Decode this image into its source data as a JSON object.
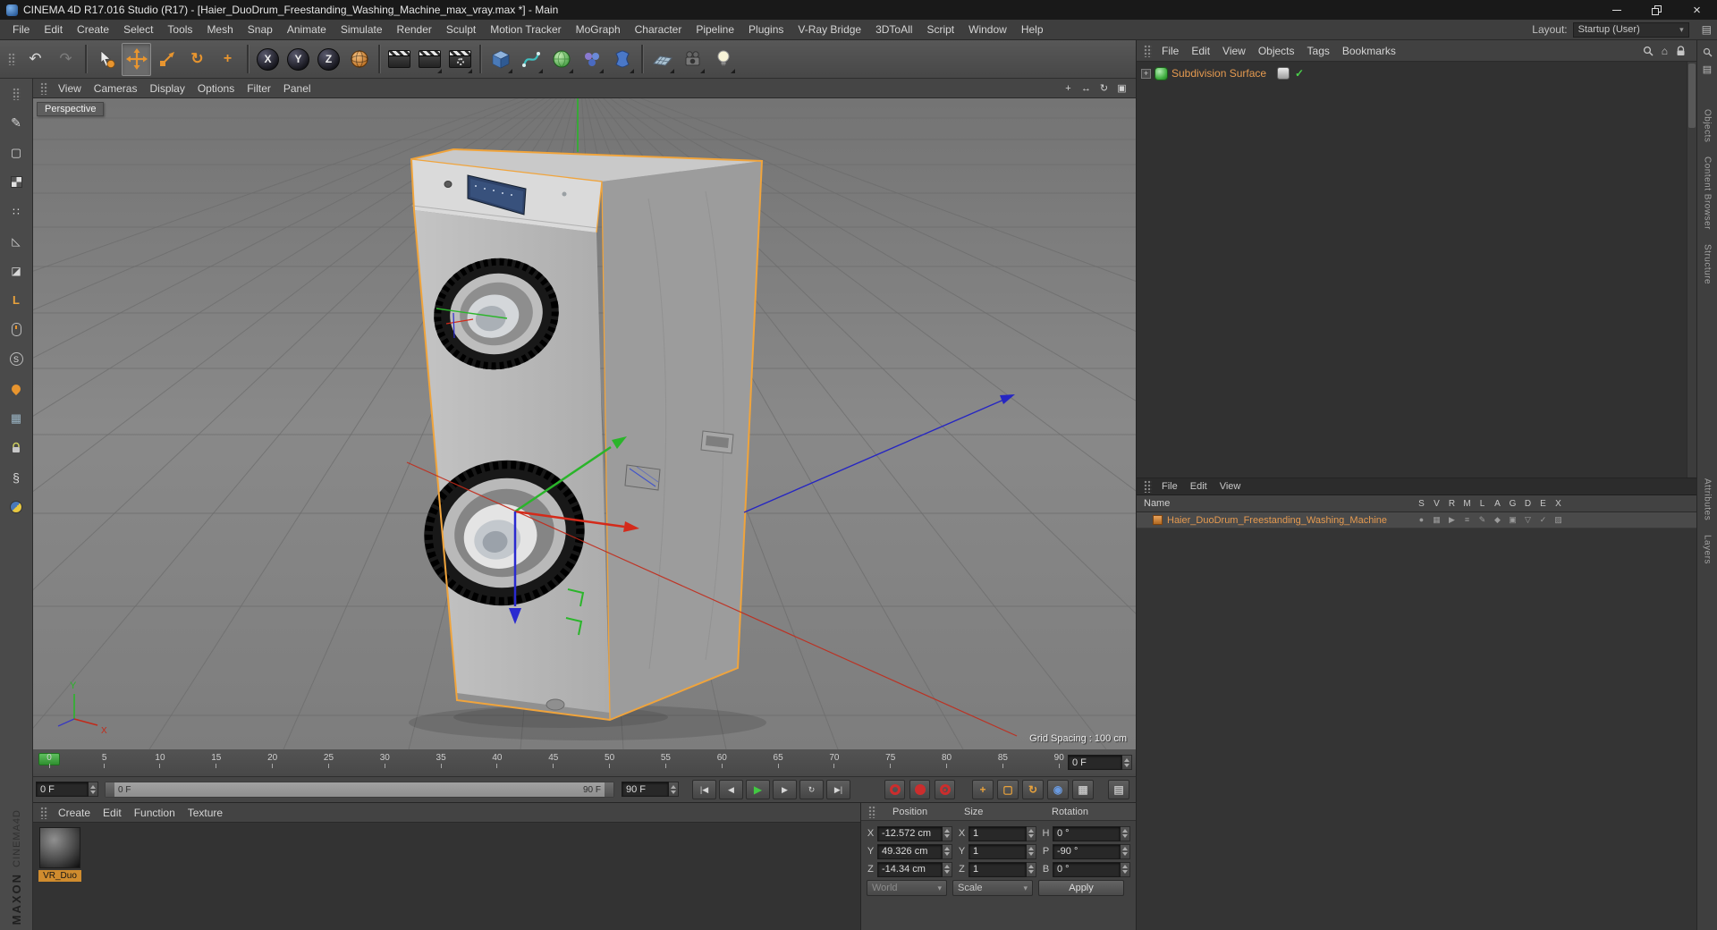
{
  "window": {
    "title": "CINEMA 4D R17.016 Studio (R17) - [Haier_DuoDrum_Freestanding_Washing_Machine_max_vray.max *] - Main"
  },
  "menubar": {
    "items": [
      "File",
      "Edit",
      "Create",
      "Select",
      "Tools",
      "Mesh",
      "Snap",
      "Animate",
      "Simulate",
      "Render",
      "Sculpt",
      "Motion Tracker",
      "MoGraph",
      "Character",
      "Pipeline",
      "Plugins",
      "V-Ray Bridge",
      "3DToAll",
      "Script",
      "Window",
      "Help"
    ],
    "layout_label": "Layout:",
    "layout_value": "Startup (User)"
  },
  "toolbar": {
    "axis_locks": [
      "X",
      "Y",
      "Z"
    ]
  },
  "viewport": {
    "menu": [
      "View",
      "Cameras",
      "Display",
      "Options",
      "Filter",
      "Panel"
    ],
    "label": "Perspective",
    "grid_spacing": "Grid Spacing : 100 cm",
    "axis_y": "Y",
    "axis_x": "X"
  },
  "object_manager": {
    "menu": [
      "File",
      "Edit",
      "View",
      "Objects",
      "Tags",
      "Bookmarks"
    ],
    "objects": [
      {
        "name": "Subdivision Surface"
      }
    ]
  },
  "layer_manager": {
    "menu": [
      "File",
      "Edit",
      "View"
    ],
    "name_header": "Name",
    "columns": [
      "S",
      "V",
      "R",
      "M",
      "L",
      "A",
      "G",
      "D",
      "E",
      "X"
    ],
    "rows": [
      {
        "name": "Haier_DuoDrum_Freestanding_Washing_Machine"
      }
    ]
  },
  "timeline": {
    "ticks": [
      "0",
      "5",
      "10",
      "15",
      "20",
      "25",
      "30",
      "35",
      "40",
      "45",
      "50",
      "55",
      "60",
      "65",
      "70",
      "75",
      "80",
      "85",
      "90"
    ],
    "current_frame": "0 F",
    "range_start": "0 F",
    "range_end": "90 F",
    "slider_start": "0 F",
    "slider_end": "90 F"
  },
  "materials": {
    "menu": [
      "Create",
      "Edit",
      "Function",
      "Texture"
    ],
    "items": [
      {
        "name": "VR_Duo"
      }
    ]
  },
  "coordinates": {
    "position_label": "Position",
    "size_label": "Size",
    "rotation_label": "Rotation",
    "position": {
      "x_label": "X",
      "x": "-12.572 cm",
      "y_label": "Y",
      "y": "49.326 cm",
      "z_label": "Z",
      "z": "-14.34 cm"
    },
    "size": {
      "x_label": "X",
      "x": "1",
      "y_label": "Y",
      "y": "1",
      "z_label": "Z",
      "z": "1"
    },
    "rotation": {
      "h_label": "H",
      "h": "0 °",
      "p_label": "P",
      "p": "-90 °",
      "b_label": "B",
      "b": "0 °"
    },
    "world": "World",
    "scale": "Scale",
    "apply": "Apply"
  },
  "branding": {
    "maxon": "MAXON",
    "cinema": "CINEMA4D"
  },
  "side_tabs": {
    "top": [
      "Objects",
      "Content Browser",
      "Structure"
    ],
    "bottom": [
      "Attributes",
      "Layers"
    ]
  },
  "colors": {
    "accent": "#e8952f",
    "axis_x": "#d42a1a",
    "axis_y": "#2ab52a",
    "axis_z": "#2a2ad0",
    "selection_outline": "#f0a43c"
  }
}
